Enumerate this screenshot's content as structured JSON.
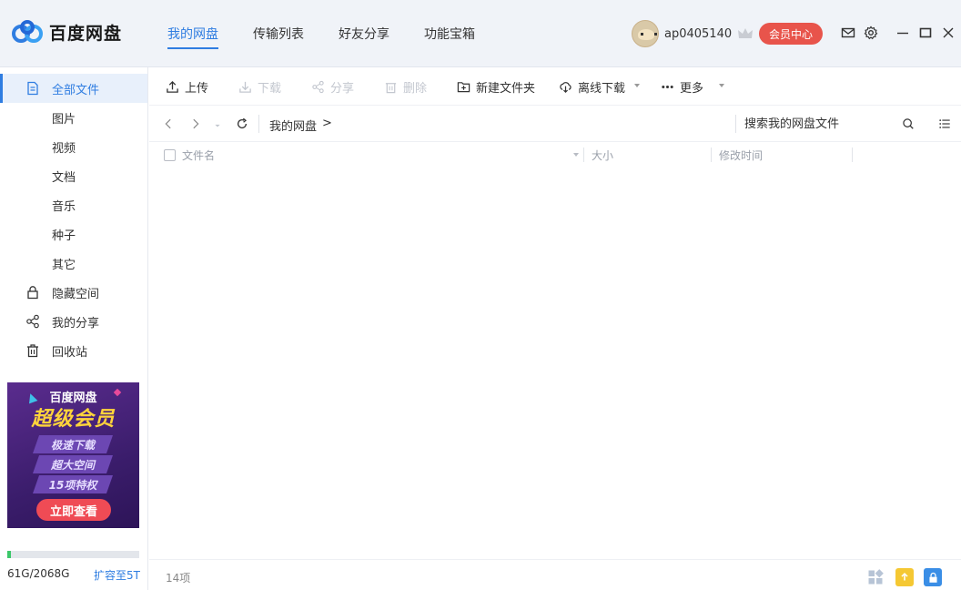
{
  "app": {
    "brand": "百度网盘"
  },
  "nav": {
    "tabs": [
      {
        "label": "我的网盘",
        "active": true
      },
      {
        "label": "传输列表"
      },
      {
        "label": "好友分享"
      },
      {
        "label": "功能宝箱"
      }
    ]
  },
  "user": {
    "name": "ap0405140",
    "vip_button": "会员中心"
  },
  "icons": {
    "mail": "mail-icon",
    "settings": "gear-icon",
    "minimize": "minimize-icon",
    "maximize": "maximize-icon",
    "close": "close-icon"
  },
  "sidebar": {
    "items": [
      {
        "label": "全部文件",
        "icon": "file-icon",
        "active": true
      },
      {
        "label": "图片"
      },
      {
        "label": "视频"
      },
      {
        "label": "文档"
      },
      {
        "label": "音乐"
      },
      {
        "label": "种子"
      },
      {
        "label": "其它"
      },
      {
        "label": "隐藏空间",
        "icon": "lock-icon"
      },
      {
        "label": "我的分享",
        "icon": "share-icon"
      },
      {
        "label": "回收站",
        "icon": "trash-icon"
      }
    ]
  },
  "ad": {
    "brand": "百度网盘",
    "title": "超级会员",
    "tags": [
      "极速下载",
      "超大空间",
      "15项特权"
    ],
    "cta": "立即查看"
  },
  "quota": {
    "used_fraction": 0.03,
    "text": "61G/2068G",
    "expand_link": "扩容至5T"
  },
  "toolbar": {
    "upload": "上传",
    "download": "下载",
    "share": "分享",
    "delete": "删除",
    "new_folder": "新建文件夹",
    "offline_download": "离线下载",
    "more": "更多"
  },
  "pathbar": {
    "crumb": "我的网盘",
    "separator": ">",
    "search_placeholder": "搜索我的网盘文件"
  },
  "columns": {
    "name": "文件名",
    "size": "大小",
    "modified": "修改时间"
  },
  "status": {
    "item_count": "14项"
  },
  "colors": {
    "accent": "#2f7de1",
    "vip": "#e8544b",
    "quota_fill": "#3cc86a"
  }
}
